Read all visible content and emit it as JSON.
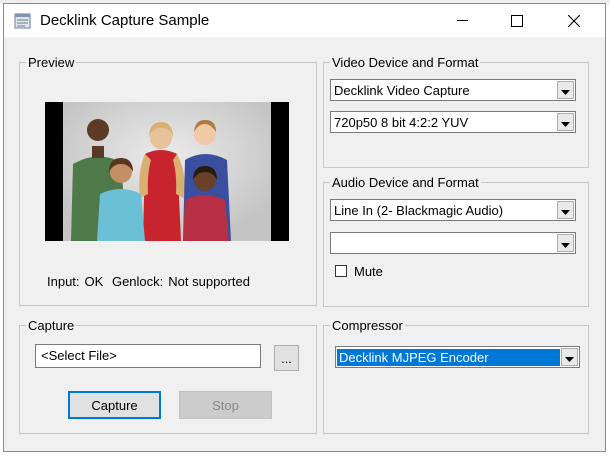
{
  "window": {
    "title": "Decklink Capture Sample",
    "icon": "application-icon"
  },
  "titlebar_buttons": {
    "minimize": "minimize-icon",
    "maximize": "maximize-icon",
    "close": "close-icon"
  },
  "preview": {
    "label": "Preview",
    "image": "video-preview-frame",
    "input_label": "Input:",
    "input_value": "OK",
    "genlock_label": "Genlock:",
    "genlock_value": "Not supported"
  },
  "video": {
    "label": "Video Device and Format",
    "device": "Decklink Video Capture",
    "format": "720p50 8 bit 4:2:2 YUV"
  },
  "audio": {
    "label": "Audio Device and Format",
    "device": "Line In (2- Blackmagic Audio)",
    "format": "",
    "mute_label": "Mute",
    "mute_checked": false
  },
  "capture": {
    "label": "Capture",
    "file": "<Select File>",
    "browse_label": "...",
    "capture_label": "Capture",
    "stop_label": "Stop"
  },
  "compressor": {
    "label": "Compressor",
    "value": "Decklink MJPEG Encoder"
  }
}
